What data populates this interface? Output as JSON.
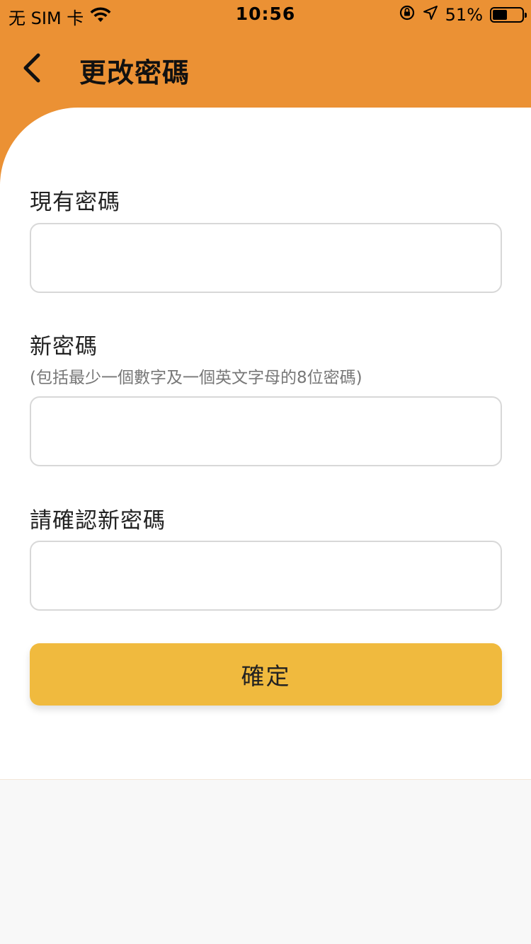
{
  "status_bar": {
    "carrier": "无 SIM 卡",
    "time": "10:56",
    "battery_percent": "51%",
    "battery_level": 0.51
  },
  "header": {
    "title": "更改密碼",
    "color": "#eb9134"
  },
  "form": {
    "current_password": {
      "label": "現有密碼",
      "value": ""
    },
    "new_password": {
      "label": "新密碼",
      "hint": "(包括最少一個數字及一個英文字母的8位密碼)",
      "value": ""
    },
    "confirm_password": {
      "label": "請確認新密碼",
      "value": ""
    },
    "submit_label": "確定",
    "submit_color": "#f0ba3e"
  },
  "icons": {
    "wifi": "wifi-icon",
    "orientation_lock": "orientation-lock-icon",
    "location": "location-arrow-icon",
    "battery": "battery-icon",
    "back": "chevron-left-icon"
  }
}
